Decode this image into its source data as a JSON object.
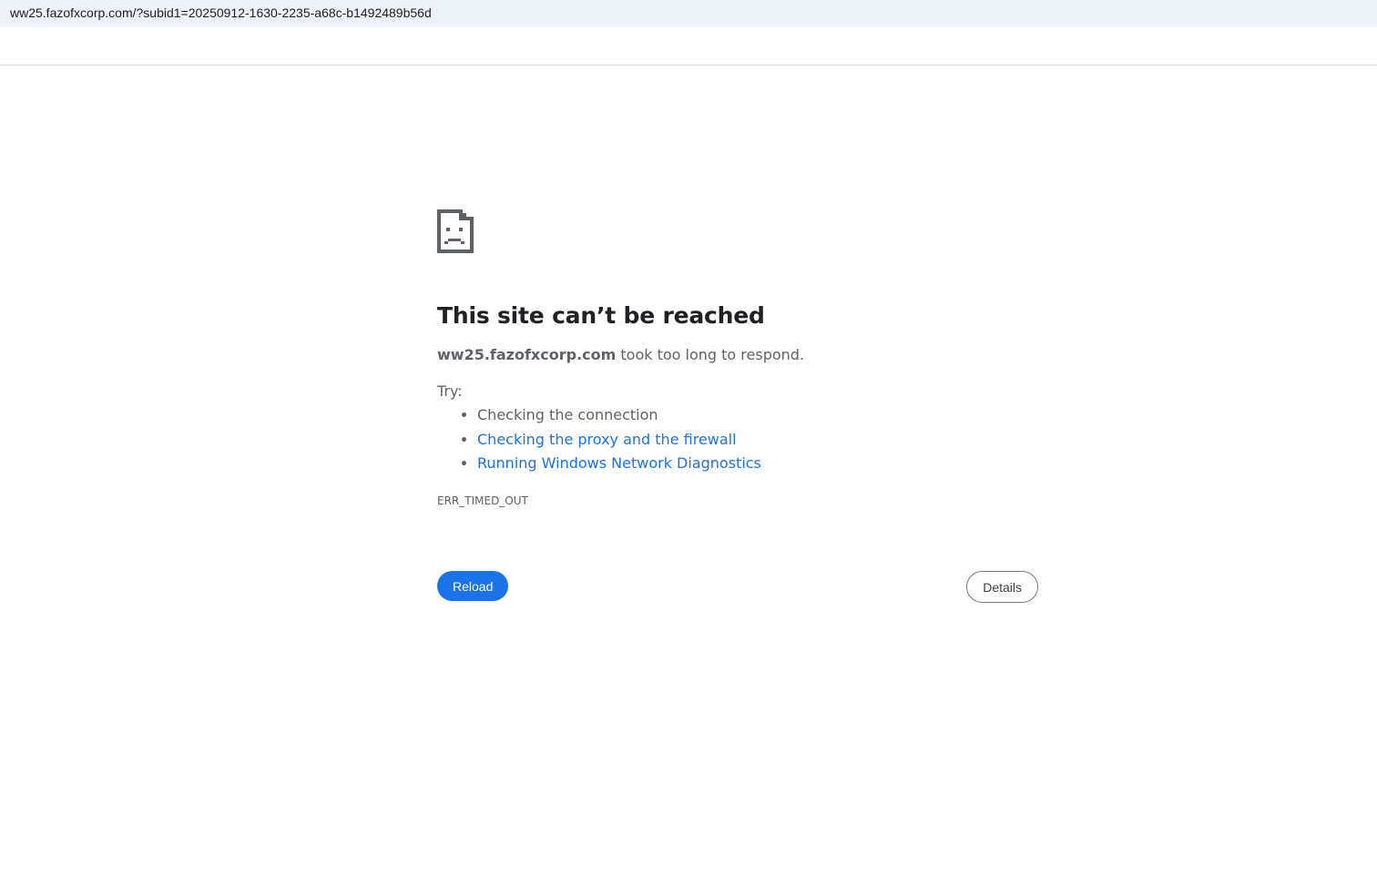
{
  "address_bar": {
    "url": "ww25.fazofxcorp.com/?subid1=20250912-1630-2235-a68c-b1492489b56d"
  },
  "error_page": {
    "icon": "sad-page-icon",
    "title": "This site can’t be reached",
    "host": "ww25.fazofxcorp.com",
    "summary_rest": " took too long to respond.",
    "try_label": "Try:",
    "suggestions": [
      {
        "label": "Checking the connection",
        "link": false
      },
      {
        "label": "Checking the proxy and the firewall",
        "link": true
      },
      {
        "label": "Running Windows Network Diagnostics",
        "link": true
      }
    ],
    "error_code": "ERR_TIMED_OUT",
    "reload_label": "Reload",
    "details_label": "Details"
  },
  "colors": {
    "accent": "#1a73e8",
    "address_bar_bg": "#eef2f9",
    "secondary_text": "#5f6368"
  }
}
